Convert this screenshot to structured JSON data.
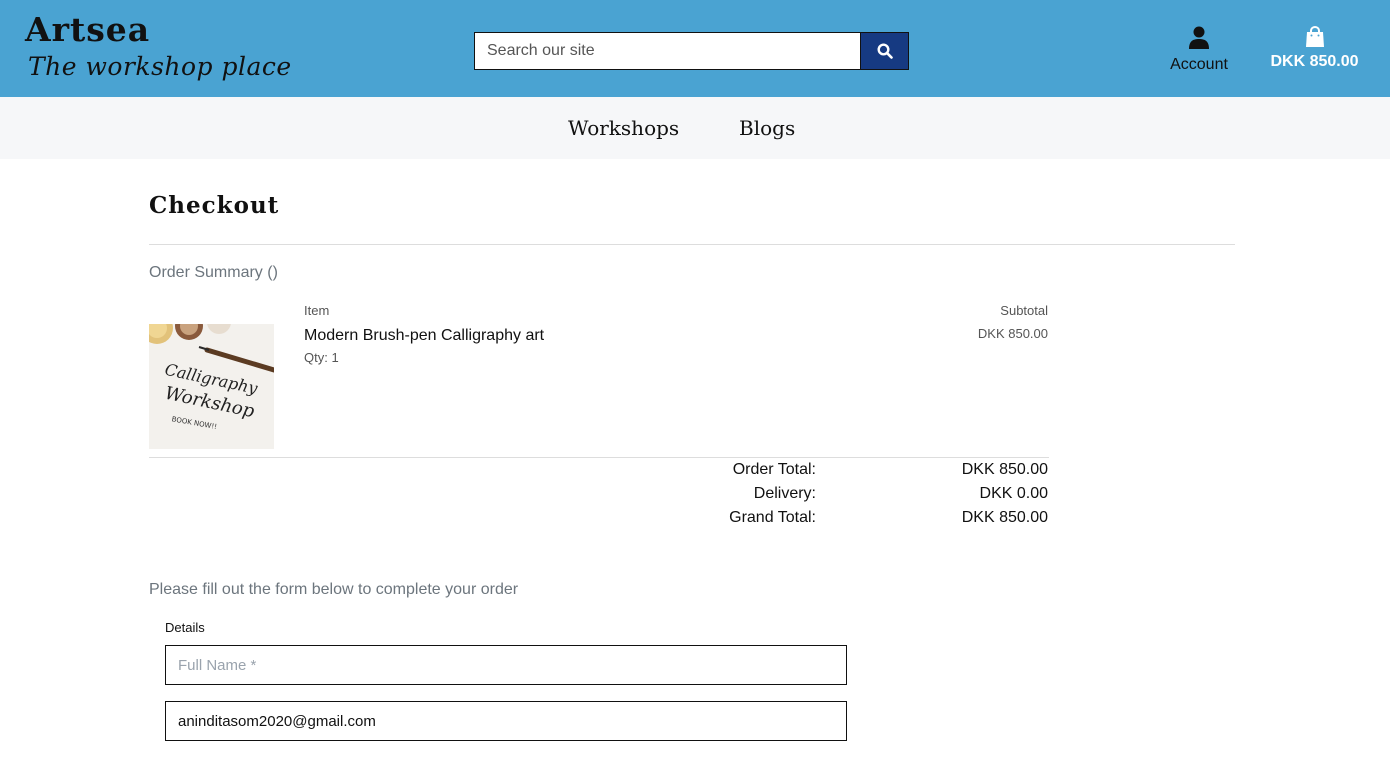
{
  "header": {
    "brand_name": "Artsea",
    "brand_tagline": "The workshop place",
    "search": {
      "placeholder": "Search our site",
      "value": ""
    },
    "account_label": "Account",
    "bag_total": "DKK 850.00",
    "colors": {
      "bar": "#4aa3d2",
      "search_button": "#163a82"
    },
    "icons": {
      "search": "search-icon",
      "account": "user-icon",
      "bag": "shopping-bag-icon"
    }
  },
  "nav": {
    "items": [
      {
        "label": "Workshops"
      },
      {
        "label": "Blogs"
      }
    ]
  },
  "main": {
    "title": "Checkout",
    "summary_heading": "Order Summary ()",
    "columns": {
      "item": "Item",
      "subtotal": "Subtotal"
    },
    "line_item": {
      "name": "Modern Brush-pen Calligraphy art",
      "qty": "Qty: 1",
      "subtotal": "DKK 850.00",
      "image_text": [
        "Calligraphy",
        "Workshop",
        "BOOK NOW!!"
      ]
    },
    "totals": [
      {
        "label": "Order Total:",
        "value": "DKK 850.00"
      },
      {
        "label": "Delivery:",
        "value": "DKK 0.00"
      },
      {
        "label": "Grand Total:",
        "value": "DKK 850.00"
      }
    ],
    "form_intro": "Please fill out the form below to complete your order",
    "details": {
      "legend": "Details",
      "full_name": {
        "placeholder": "Full Name *",
        "value": ""
      },
      "email": {
        "placeholder": "",
        "value": "aninditasom2020@gmail.com"
      }
    }
  }
}
